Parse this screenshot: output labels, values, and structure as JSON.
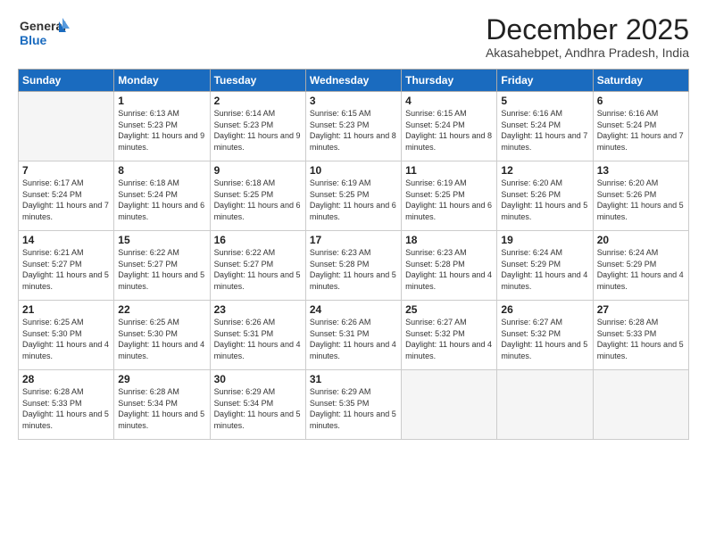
{
  "header": {
    "logo_general": "General",
    "logo_blue": "Blue",
    "month_title": "December 2025",
    "subtitle": "Akasahebpet, Andhra Pradesh, India"
  },
  "weekdays": [
    "Sunday",
    "Monday",
    "Tuesday",
    "Wednesday",
    "Thursday",
    "Friday",
    "Saturday"
  ],
  "weeks": [
    [
      {
        "day": "",
        "sunrise": "",
        "sunset": "",
        "daylight": ""
      },
      {
        "day": "1",
        "sunrise": "6:13 AM",
        "sunset": "5:23 PM",
        "daylight": "11 hours and 9 minutes."
      },
      {
        "day": "2",
        "sunrise": "6:14 AM",
        "sunset": "5:23 PM",
        "daylight": "11 hours and 9 minutes."
      },
      {
        "day": "3",
        "sunrise": "6:15 AM",
        "sunset": "5:23 PM",
        "daylight": "11 hours and 8 minutes."
      },
      {
        "day": "4",
        "sunrise": "6:15 AM",
        "sunset": "5:24 PM",
        "daylight": "11 hours and 8 minutes."
      },
      {
        "day": "5",
        "sunrise": "6:16 AM",
        "sunset": "5:24 PM",
        "daylight": "11 hours and 7 minutes."
      },
      {
        "day": "6",
        "sunrise": "6:16 AM",
        "sunset": "5:24 PM",
        "daylight": "11 hours and 7 minutes."
      }
    ],
    [
      {
        "day": "7",
        "sunrise": "6:17 AM",
        "sunset": "5:24 PM",
        "daylight": "11 hours and 7 minutes."
      },
      {
        "day": "8",
        "sunrise": "6:18 AM",
        "sunset": "5:24 PM",
        "daylight": "11 hours and 6 minutes."
      },
      {
        "day": "9",
        "sunrise": "6:18 AM",
        "sunset": "5:25 PM",
        "daylight": "11 hours and 6 minutes."
      },
      {
        "day": "10",
        "sunrise": "6:19 AM",
        "sunset": "5:25 PM",
        "daylight": "11 hours and 6 minutes."
      },
      {
        "day": "11",
        "sunrise": "6:19 AM",
        "sunset": "5:25 PM",
        "daylight": "11 hours and 6 minutes."
      },
      {
        "day": "12",
        "sunrise": "6:20 AM",
        "sunset": "5:26 PM",
        "daylight": "11 hours and 5 minutes."
      },
      {
        "day": "13",
        "sunrise": "6:20 AM",
        "sunset": "5:26 PM",
        "daylight": "11 hours and 5 minutes."
      }
    ],
    [
      {
        "day": "14",
        "sunrise": "6:21 AM",
        "sunset": "5:27 PM",
        "daylight": "11 hours and 5 minutes."
      },
      {
        "day": "15",
        "sunrise": "6:22 AM",
        "sunset": "5:27 PM",
        "daylight": "11 hours and 5 minutes."
      },
      {
        "day": "16",
        "sunrise": "6:22 AM",
        "sunset": "5:27 PM",
        "daylight": "11 hours and 5 minutes."
      },
      {
        "day": "17",
        "sunrise": "6:23 AM",
        "sunset": "5:28 PM",
        "daylight": "11 hours and 5 minutes."
      },
      {
        "day": "18",
        "sunrise": "6:23 AM",
        "sunset": "5:28 PM",
        "daylight": "11 hours and 4 minutes."
      },
      {
        "day": "19",
        "sunrise": "6:24 AM",
        "sunset": "5:29 PM",
        "daylight": "11 hours and 4 minutes."
      },
      {
        "day": "20",
        "sunrise": "6:24 AM",
        "sunset": "5:29 PM",
        "daylight": "11 hours and 4 minutes."
      }
    ],
    [
      {
        "day": "21",
        "sunrise": "6:25 AM",
        "sunset": "5:30 PM",
        "daylight": "11 hours and 4 minutes."
      },
      {
        "day": "22",
        "sunrise": "6:25 AM",
        "sunset": "5:30 PM",
        "daylight": "11 hours and 4 minutes."
      },
      {
        "day": "23",
        "sunrise": "6:26 AM",
        "sunset": "5:31 PM",
        "daylight": "11 hours and 4 minutes."
      },
      {
        "day": "24",
        "sunrise": "6:26 AM",
        "sunset": "5:31 PM",
        "daylight": "11 hours and 4 minutes."
      },
      {
        "day": "25",
        "sunrise": "6:27 AM",
        "sunset": "5:32 PM",
        "daylight": "11 hours and 4 minutes."
      },
      {
        "day": "26",
        "sunrise": "6:27 AM",
        "sunset": "5:32 PM",
        "daylight": "11 hours and 5 minutes."
      },
      {
        "day": "27",
        "sunrise": "6:28 AM",
        "sunset": "5:33 PM",
        "daylight": "11 hours and 5 minutes."
      }
    ],
    [
      {
        "day": "28",
        "sunrise": "6:28 AM",
        "sunset": "5:33 PM",
        "daylight": "11 hours and 5 minutes."
      },
      {
        "day": "29",
        "sunrise": "6:28 AM",
        "sunset": "5:34 PM",
        "daylight": "11 hours and 5 minutes."
      },
      {
        "day": "30",
        "sunrise": "6:29 AM",
        "sunset": "5:34 PM",
        "daylight": "11 hours and 5 minutes."
      },
      {
        "day": "31",
        "sunrise": "6:29 AM",
        "sunset": "5:35 PM",
        "daylight": "11 hours and 5 minutes."
      },
      {
        "day": "",
        "sunrise": "",
        "sunset": "",
        "daylight": ""
      },
      {
        "day": "",
        "sunrise": "",
        "sunset": "",
        "daylight": ""
      },
      {
        "day": "",
        "sunrise": "",
        "sunset": "",
        "daylight": ""
      }
    ]
  ]
}
